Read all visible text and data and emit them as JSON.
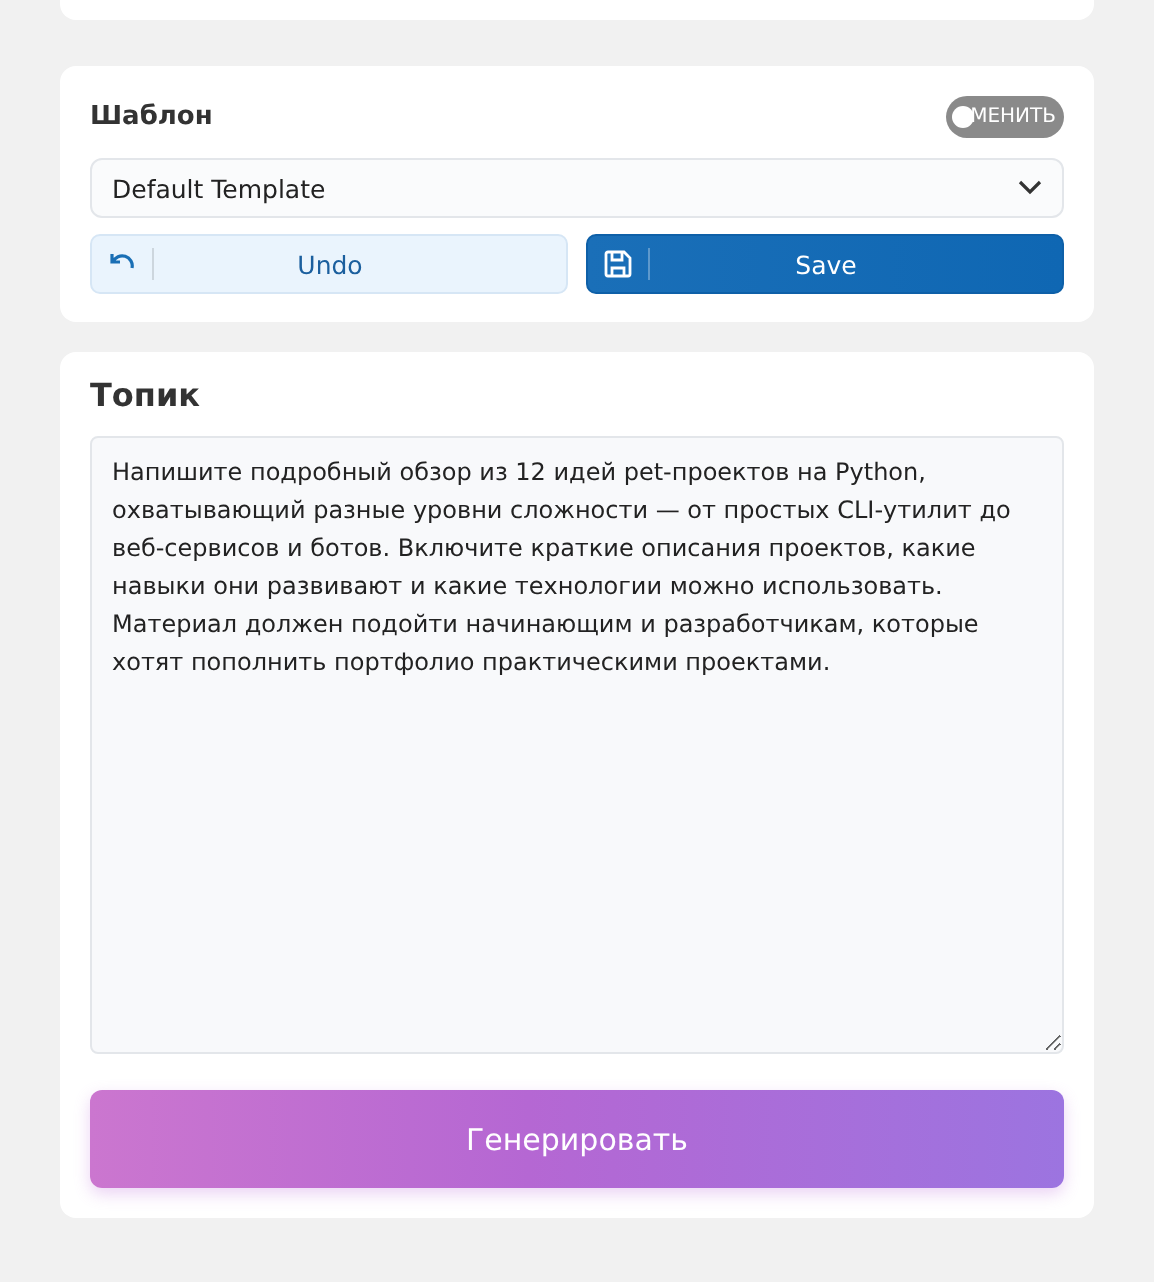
{
  "template_panel": {
    "title": "Шаблон",
    "toggle": {
      "label": "МЕНИТЬ",
      "on": false
    },
    "select": {
      "value": "Default Template"
    },
    "buttons": [
      {
        "kind": "undo",
        "label": "Undo"
      },
      {
        "kind": "save",
        "label": "Save"
      }
    ]
  },
  "topic_panel": {
    "title": "Топик",
    "text": "Напишите подробный обзор из 12 идей pet-проектов на Python, охватывающий разные уровни сложности — от простых CLI-утилит до веб-сервисов и ботов. Включите краткие описания проектов, какие навыки они развивают и какие технологии можно использовать. Материал должен подойти начинающим и разработчикам, которые хотят пополнить портфолио практическими проектами.",
    "generate_button": "Генерировать"
  }
}
